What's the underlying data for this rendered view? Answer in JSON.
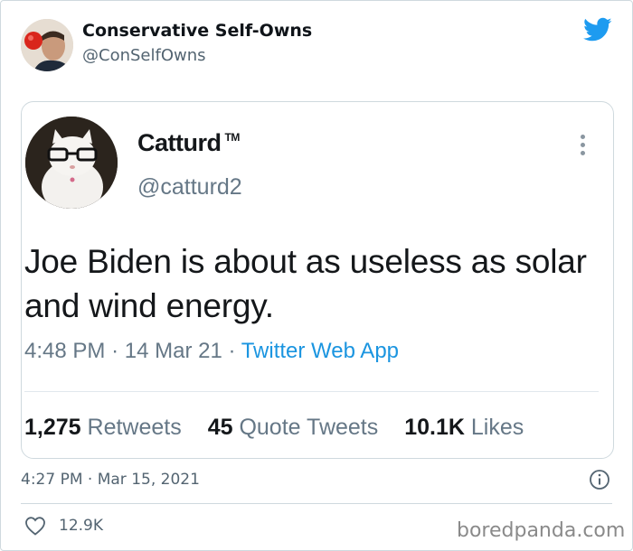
{
  "outer_tweet": {
    "author_name": "Conservative Self-Owns",
    "author_handle": "@ConSelfOwns",
    "timestamp": "4:27 PM · Mar 15, 2021",
    "likes": "12.9K",
    "brand_color": "#1d9bf0"
  },
  "quoted_screenshot": {
    "author_name": "Catturd",
    "author_mark": "TM",
    "author_handle": "@catturd2",
    "text": "Joe Biden is about as useless as solar and wind energy.",
    "time": "4:48 PM",
    "date": "14 Mar 21",
    "separator": "·",
    "app": "Twitter Web App",
    "stats": {
      "retweets_count": "1,275",
      "retweets_label": "Retweets",
      "quotes_count": "45",
      "quotes_label": "Quote Tweets",
      "likes_count": "10.1K",
      "likes_label": "Likes"
    }
  },
  "watermark": "boredpanda.com",
  "icons": [
    "twitter-bird-icon",
    "more-options-icon",
    "info-icon",
    "heart-icon"
  ]
}
